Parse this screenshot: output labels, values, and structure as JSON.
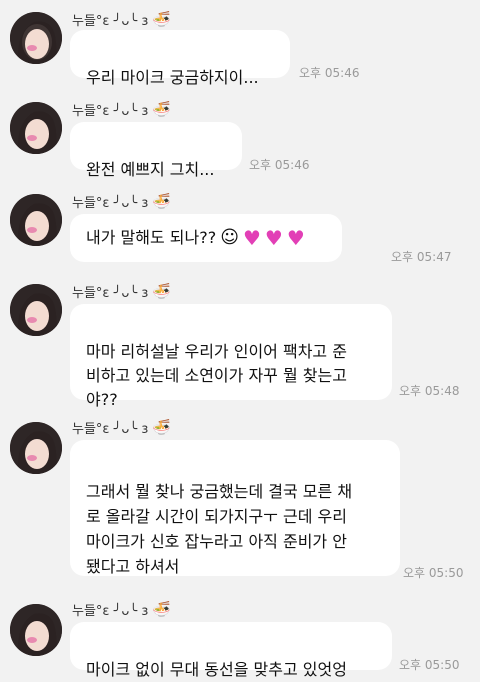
{
  "sender": {
    "name": "누들°ɛ ╯ᴗ╰ ɜ",
    "name_suffix_icon": "noodle-bowl-icon"
  },
  "messages": [
    {
      "text": "우리 마이크 궁금하지이...",
      "time": "오후 05:46"
    },
    {
      "text": "완전 예쁘지 그치...",
      "time": "오후 05:46"
    },
    {
      "text": "내가 말해도 되나??",
      "emoji": "☺",
      "hearts": "♥♥♥",
      "time": "오후 05:47"
    },
    {
      "text": "마마 리허설날 우리가 인이어 팩차고 준\n비하고 있는데 소연이가 자꾸 뭘 찾는고\n야??",
      "time": "오후 05:48"
    },
    {
      "text": "그래서 뭘 찾나 궁금했는데 결국 모른 채\n로 올라갈 시간이 되가지구ㅜ 근데 우리\n마이크가 신호 잡누라고 아직 준비가 안\n됐다고 하셔서",
      "time": "오후 05:50"
    },
    {
      "text": "마이크 없이 무대 동선을 맞추고 있엇엉",
      "time": "오후 05:50"
    }
  ]
}
